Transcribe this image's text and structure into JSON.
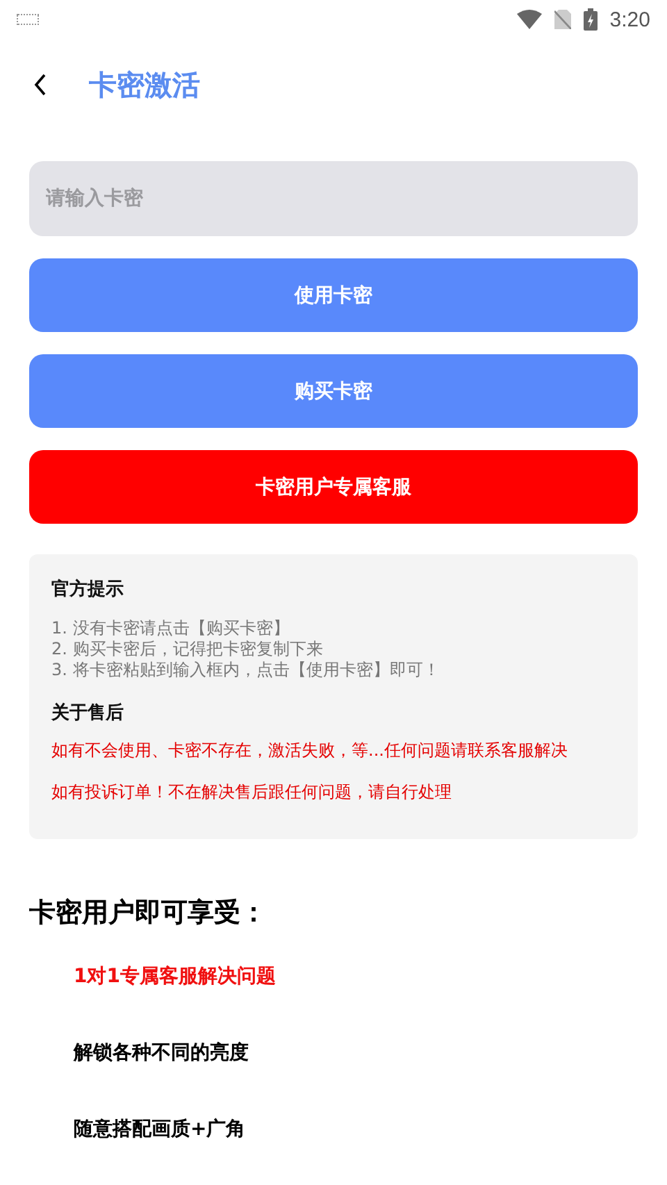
{
  "status_bar": {
    "time": "3:20"
  },
  "header": {
    "title": "卡密激活"
  },
  "card_input": {
    "placeholder": "请输入卡密"
  },
  "buttons": [
    {
      "label": "使用卡密",
      "kind": "primary"
    },
    {
      "label": "购买卡密",
      "kind": "primary"
    },
    {
      "label": "卡密用户专属客服",
      "kind": "danger"
    }
  ],
  "notice": {
    "title": "官方提示",
    "lines": [
      "1. 没有卡密请点击【购买卡密】",
      "2. 购买卡密后，记得把卡密复制下来",
      "3. 将卡密粘贴到输入框内，点击【使用卡密】即可！"
    ],
    "after_sales_title": "关于售后",
    "after_sales": [
      "如有不会使用、卡密不存在，激活失败，等...任何问题请联系客服解决",
      "如有投诉订单！不在解决售后跟任何问题，请自行处理"
    ]
  },
  "benefits": {
    "title": "卡密用户即可享受：",
    "items": [
      {
        "text": "1对1专属客服解决问题",
        "highlight": true
      },
      {
        "text": "解锁各种不同的亮度",
        "highlight": false
      },
      {
        "text": "随意搭配画质+广角",
        "highlight": false
      }
    ]
  }
}
